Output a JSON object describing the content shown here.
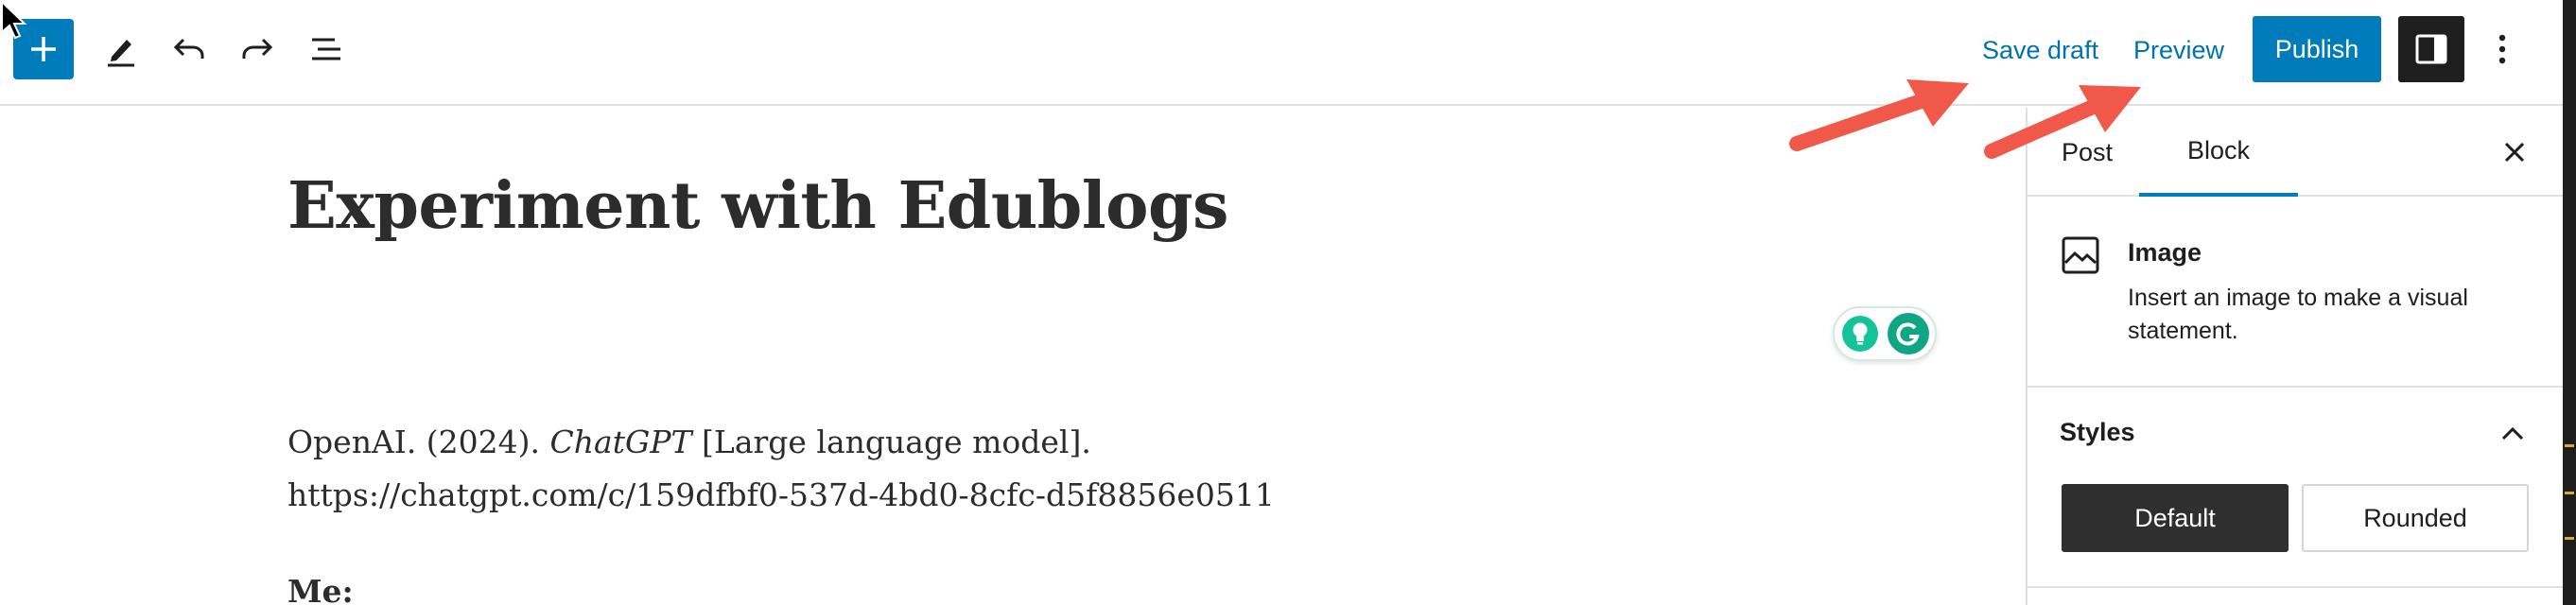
{
  "toolbar": {
    "save_draft_label": "Save draft",
    "preview_label": "Preview",
    "publish_label": "Publish"
  },
  "post": {
    "title": "Experiment with Edublogs",
    "paragraph_prefix": "OpenAI. (2024). ",
    "paragraph_italic": "ChatGPT",
    "paragraph_suffix": " [Large language model]. https://chatgpt.com/c/159dfbf0-537d-4bd0-8cfc-d5f8856e0511",
    "next_line": "Me:"
  },
  "sidebar": {
    "tabs": [
      "Post",
      "Block"
    ],
    "active_tab": "Block",
    "block": {
      "name": "Image",
      "description": "Insert an image to make a visual statement."
    },
    "styles": {
      "title": "Styles",
      "options": [
        "Default",
        "Rounded"
      ],
      "selected": "Default"
    }
  },
  "colors": {
    "accent": "#007cba",
    "arrow": "#f0594a",
    "grammarly": "#15c39a"
  }
}
